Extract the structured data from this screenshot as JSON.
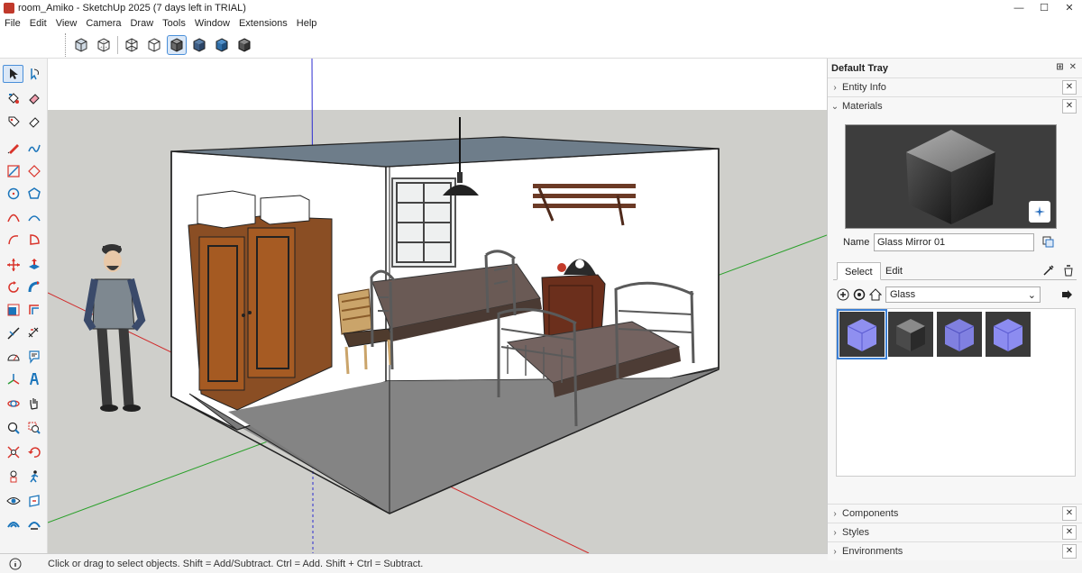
{
  "window": {
    "title": "room_Amiko - SketchUp 2025 (7 days left in TRIAL)",
    "controls": [
      "—",
      "☐",
      "✕"
    ]
  },
  "menu": [
    "File",
    "Edit",
    "View",
    "Camera",
    "Draw",
    "Tools",
    "Window",
    "Extensions",
    "Help"
  ],
  "style_toolbar": {
    "buttons": [
      "xray-style",
      "back-edges-style",
      "wireframe-style",
      "hidden-line-style",
      "shaded-style",
      "shaded-textures-style",
      "monochrome-style",
      "ambient-occlusion-style"
    ],
    "active": "shaded-style"
  },
  "tools": {
    "rows": [
      [
        "select",
        "orbit-lasso"
      ],
      [
        "paint-bucket",
        "eraser"
      ],
      [
        "tag",
        "eraser-alt"
      ],
      [
        "pencil",
        "freehand"
      ],
      [
        "rectangle",
        "rotated-rectangle"
      ],
      [
        "circle",
        "polygon"
      ],
      [
        "arc",
        "arc-2pt"
      ],
      [
        "arc-3pt",
        "pie"
      ],
      [
        "move",
        "push-pull"
      ],
      [
        "rotate",
        "follow-me"
      ],
      [
        "scale",
        "offset"
      ],
      [
        "tape-measure",
        "dimension"
      ],
      [
        "protractor",
        "text"
      ],
      [
        "axes",
        "3d-text"
      ],
      [
        "orbit",
        "pan"
      ],
      [
        "zoom",
        "zoom-window"
      ],
      [
        "zoom-extents",
        "previous-view"
      ],
      [
        "position-camera",
        "walk"
      ],
      [
        "look-around",
        "section-plane"
      ],
      [
        "section-display",
        "section-fill"
      ]
    ],
    "active": "select"
  },
  "status": {
    "text": "Click or drag to select objects. Shift = Add/Subtract. Ctrl = Add. Shift + Ctrl = Subtract."
  },
  "tray": {
    "title": "Default Tray",
    "panels_top": [
      {
        "label": "Entity Info",
        "expanded": false
      },
      {
        "label": "Materials",
        "expanded": true
      }
    ],
    "panels_bottom": [
      {
        "label": "Components",
        "expanded": false
      },
      {
        "label": "Styles",
        "expanded": false
      },
      {
        "label": "Environments",
        "expanded": false
      }
    ],
    "materials": {
      "name_label": "Name",
      "name_value": "Glass Mirror 01",
      "tabs": [
        "Select",
        "Edit"
      ],
      "active_tab": "Select",
      "library": "Glass",
      "swatches": [
        {
          "color": "#8f8ff0",
          "kind": "glass-blue",
          "selected": true
        },
        {
          "color": "#3c3c3c",
          "kind": "glass-dark",
          "selected": false
        },
        {
          "color": "#8080e0",
          "kind": "glass-blue",
          "selected": false
        },
        {
          "color": "#8c8cf0",
          "kind": "glass-blue",
          "selected": false
        }
      ]
    }
  }
}
